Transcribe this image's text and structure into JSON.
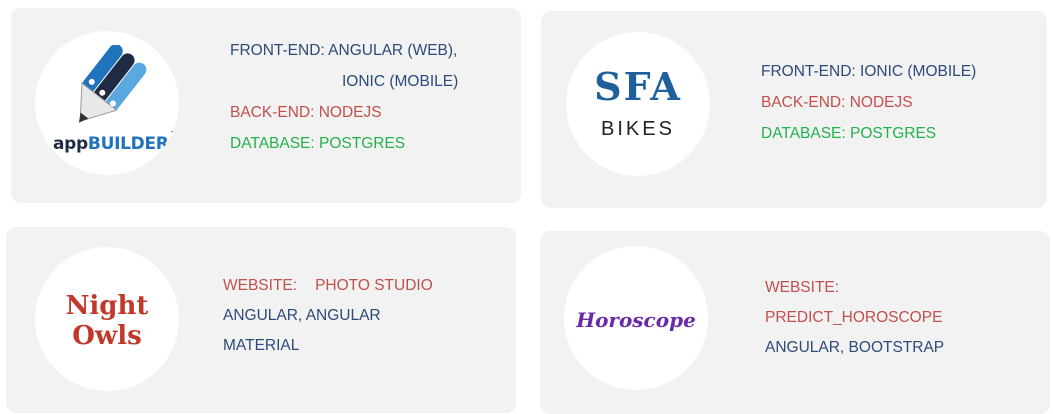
{
  "cards": [
    {
      "logo": {
        "icon": "pencil-stack-icon",
        "text_main": "app",
        "text_accent": "BUILDER",
        "tm": "TM"
      },
      "lines": [
        "FRONT-END: ANGULAR (WEB),",
        "IONIC (MOBILE)",
        "BACK-END: NODEJS",
        "DATABASE: POSTGRES"
      ]
    },
    {
      "logo": {
        "text_main": "SFA",
        "text_sub": "BIKES"
      },
      "lines": [
        "FRONT-END: IONIC (MOBILE)",
        "BACK-END: NODEJS",
        "DATABASE: POSTGRES"
      ]
    },
    {
      "logo": {
        "line1": "Night",
        "line2": "Owls"
      },
      "lines": [
        "WEBSITE:",
        "PHOTO STUDIO",
        "ANGULAR, ANGULAR",
        "MATERIAL"
      ]
    },
    {
      "logo": {
        "text": "Horoscope"
      },
      "lines": [
        "WEBSITE:",
        "PREDICT_HOROSCOPE",
        "ANGULAR, BOOTSTRAP"
      ]
    }
  ],
  "colors": {
    "blue": "#2c4a7a",
    "red": "#c0504d",
    "green": "#22b14c",
    "card": "#f2f2f2"
  }
}
